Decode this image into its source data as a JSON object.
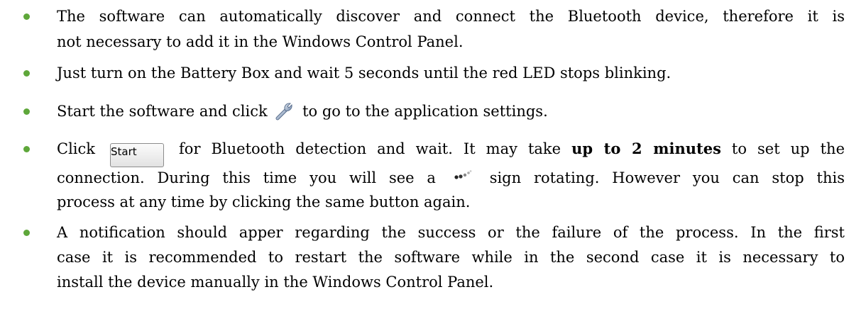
{
  "bullets": [
    {
      "lines": [
        "The software can automatically discover and connect the Bluetooth device, therefore it is",
        "not necessary to add it in the Windows Control Panel."
      ]
    },
    {
      "lines": [
        "Just turn on the Battery Box and wait 5 seconds until the red LED stops blinking."
      ]
    },
    {
      "pre": "Start the software and click",
      "icon": "wrench-icon",
      "post": "to go to the application settings."
    },
    {
      "pre": "Click",
      "button_label": "Start",
      "mid": "for Bluetooth detection and wait. It may take",
      "bold": "up to 2 minutes",
      "end": "to set up the",
      "line2_pre": "connection. During this time you will see a",
      "spinner_icon": "spinner-icon",
      "line2_post": "sign rotating. However you can stop this",
      "line3": "process at any time by clicking the same button again."
    },
    {
      "lines": [
        "A notification should apper regarding the success or the failure of the process. In the first",
        "case it is recommended to restart the software while in the second case it is necessary to",
        "install the device manually in the Windows Control Panel."
      ]
    }
  ],
  "colors": {
    "bullet": "#5ea73a",
    "text": "#000000"
  }
}
